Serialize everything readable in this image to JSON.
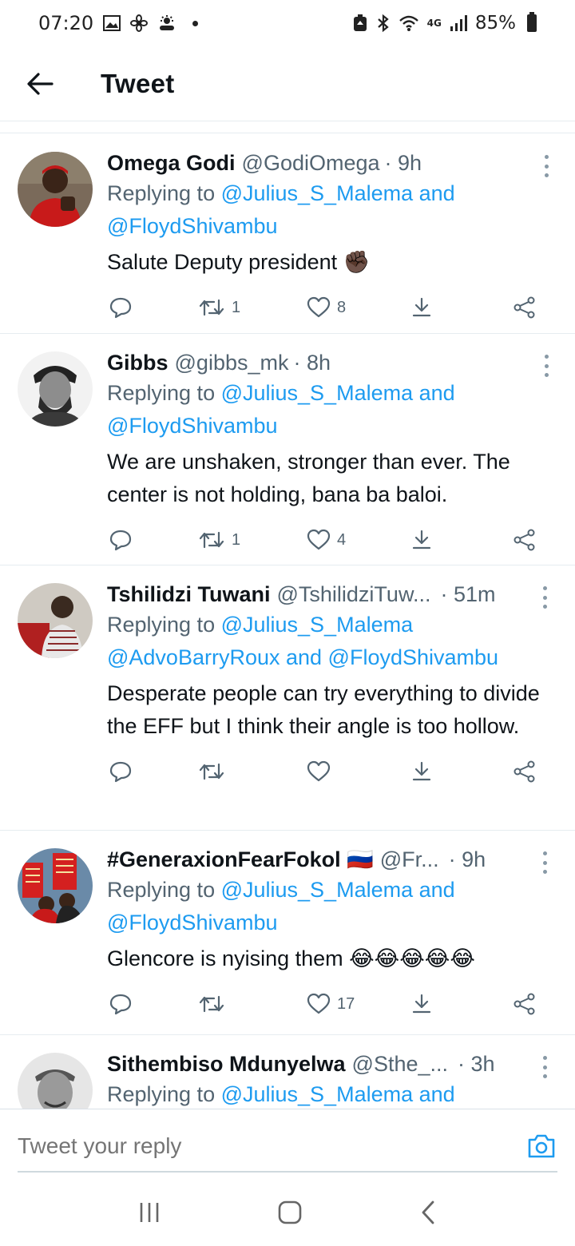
{
  "status_bar": {
    "time": "07:20",
    "battery": "85%",
    "network": "4G",
    "left_icons": [
      "gallery-icon",
      "fan-icon",
      "weather-icon",
      "dot-icon"
    ],
    "right_icons": [
      "battery-saver-icon",
      "bluetooth-icon",
      "wifi-icon",
      "signal-icon"
    ]
  },
  "header": {
    "title": "Tweet",
    "back_icon": "arrow-left-icon"
  },
  "tweets": [
    {
      "name": "Omega Godi",
      "handle": "@GodiOmega",
      "time": "· 9h",
      "replying_prefix": "Replying to ",
      "replying_line1": "@Julius_S_Malema and",
      "replying_line2": "@FloydShivambu",
      "text": "Salute Deputy president ✊🏿",
      "retweets": "1",
      "likes": "8"
    },
    {
      "name": "Gibbs",
      "handle": "@gibbs_mk",
      "time": "· 8h",
      "replying_prefix": "Replying to ",
      "replying_line1": "@Julius_S_Malema and",
      "replying_line2": "@FloydShivambu",
      "text": "We are unshaken, stronger than ever. The center is not holding, bana ba baloi.",
      "retweets": "1",
      "likes": "4"
    },
    {
      "name": "Tshilidzi Tuwani",
      "handle": "@TshilidziTuw...",
      "time": "· 51m",
      "replying_prefix": "Replying to ",
      "replying_line1": "@Julius_S_Malema",
      "replying_line2": "@AdvoBarryRoux and @FloydShivambu",
      "text": "Desperate people can try everything to divide the EFF but I think their angle is too hollow.",
      "retweets": "",
      "likes": ""
    },
    {
      "name": "#GeneraxionFearFokol 🇷🇺",
      "handle": "@Fr...",
      "time": "· 9h",
      "replying_prefix": "Replying to ",
      "replying_line1": "@Julius_S_Malema and",
      "replying_line2": "@FloydShivambu",
      "text": "Glencore is nyising them 😂😂😂😂😂",
      "retweets": "",
      "likes": "17"
    },
    {
      "name": "Sithembiso Mdunyelwa",
      "handle": "@Sthe_...",
      "time": "· 3h",
      "replying_prefix": "Replying to ",
      "replying_line1": "@Julius_S_Malema and",
      "replying_line2": "",
      "text": "",
      "retweets": "",
      "likes": ""
    }
  ],
  "reply_bar": {
    "placeholder": "Tweet your reply",
    "camera_icon": "camera-icon"
  },
  "nav_bar": {
    "icons": [
      "recent-apps-icon",
      "home-icon",
      "back-icon"
    ]
  },
  "colors": {
    "link": "#1d9bf0",
    "secondary_text": "#536471",
    "divider": "#e6ecf0"
  }
}
